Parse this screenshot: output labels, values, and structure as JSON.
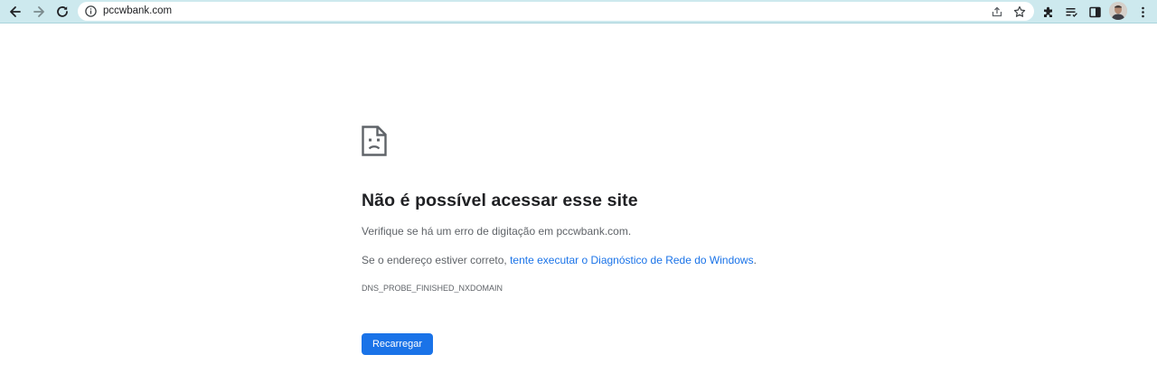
{
  "browser": {
    "url": "pccwbank.com"
  },
  "error_page": {
    "heading": "Não é possível acessar esse site",
    "line1": "Verifique se há um erro de digitação em pccwbank.com.",
    "line2_prefix": "Se o endereço estiver correto, ",
    "line2_link": "tente executar o Diagnóstico de Rede do Windows",
    "line2_suffix": ".",
    "error_code": "DNS_PROBE_FINISHED_NXDOMAIN",
    "reload_label": "Recarregar"
  },
  "colors": {
    "toolbar_bg": "#cde9ee",
    "link": "#1a73e8",
    "button": "#1a73e8",
    "heading": "#202124",
    "body_text": "#5f6368"
  },
  "icons": {
    "back": "arrow-left-icon",
    "forward": "arrow-right-icon",
    "reload": "reload-icon",
    "site_info": "info-icon",
    "share": "share-icon",
    "bookmark": "star-icon",
    "extensions": "puzzle-icon",
    "reading_list": "reading-list-icon",
    "side_panel": "side-panel-icon",
    "menu": "kebab-menu-icon",
    "page_error": "sad-document-icon"
  }
}
